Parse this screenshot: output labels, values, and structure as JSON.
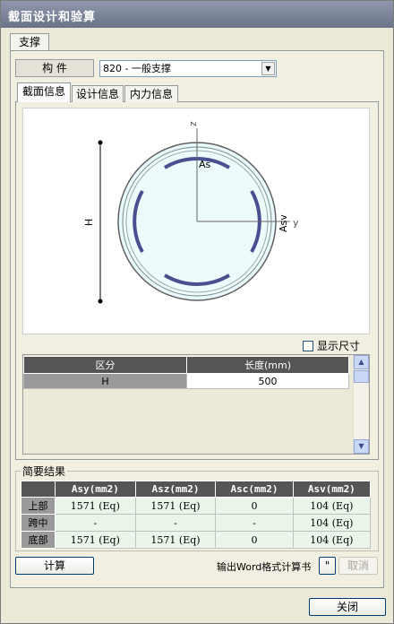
{
  "window": {
    "title": "截面设计和验算"
  },
  "outer_tabs": [
    "支撑"
  ],
  "component": {
    "label": "构 件",
    "selected": "820 - 一般支撑"
  },
  "inner_tabs": [
    "截面信息",
    "设计信息",
    "内力信息"
  ],
  "diagram": {
    "labels": {
      "z": "z",
      "y": "y",
      "as": "As",
      "asv": "Asv",
      "h": "H"
    }
  },
  "show_dims": {
    "label": "显示尺寸",
    "checked": false
  },
  "dims_table": {
    "headers": [
      "区分",
      "长度(mm)"
    ],
    "rows": [
      [
        "H",
        "500"
      ]
    ]
  },
  "results": {
    "title": "简要结果",
    "headers": [
      "",
      "Asy(mm2)",
      "Asz(mm2)",
      "Asc(mm2)",
      "Asv(mm2)"
    ],
    "rows": [
      [
        "上部",
        "1571 (Eq)",
        "1571 (Eq)",
        "0",
        "104 (Eq)"
      ],
      [
        "跨中",
        "-",
        "-",
        "-",
        "104 (Eq)"
      ],
      [
        "底部",
        "1571 (Eq)",
        "1571 (Eq)",
        "0",
        "104 (Eq)"
      ]
    ]
  },
  "buttons": {
    "calculate": "计算",
    "export_label": "输出Word格式计算书",
    "export_dots": "\"",
    "cancel": "取消",
    "close": "关闭"
  },
  "icons": {
    "combo_arrow": "chevron-down-icon",
    "scroll_up": "chevron-up-icon",
    "scroll_down": "chevron-down-icon"
  }
}
